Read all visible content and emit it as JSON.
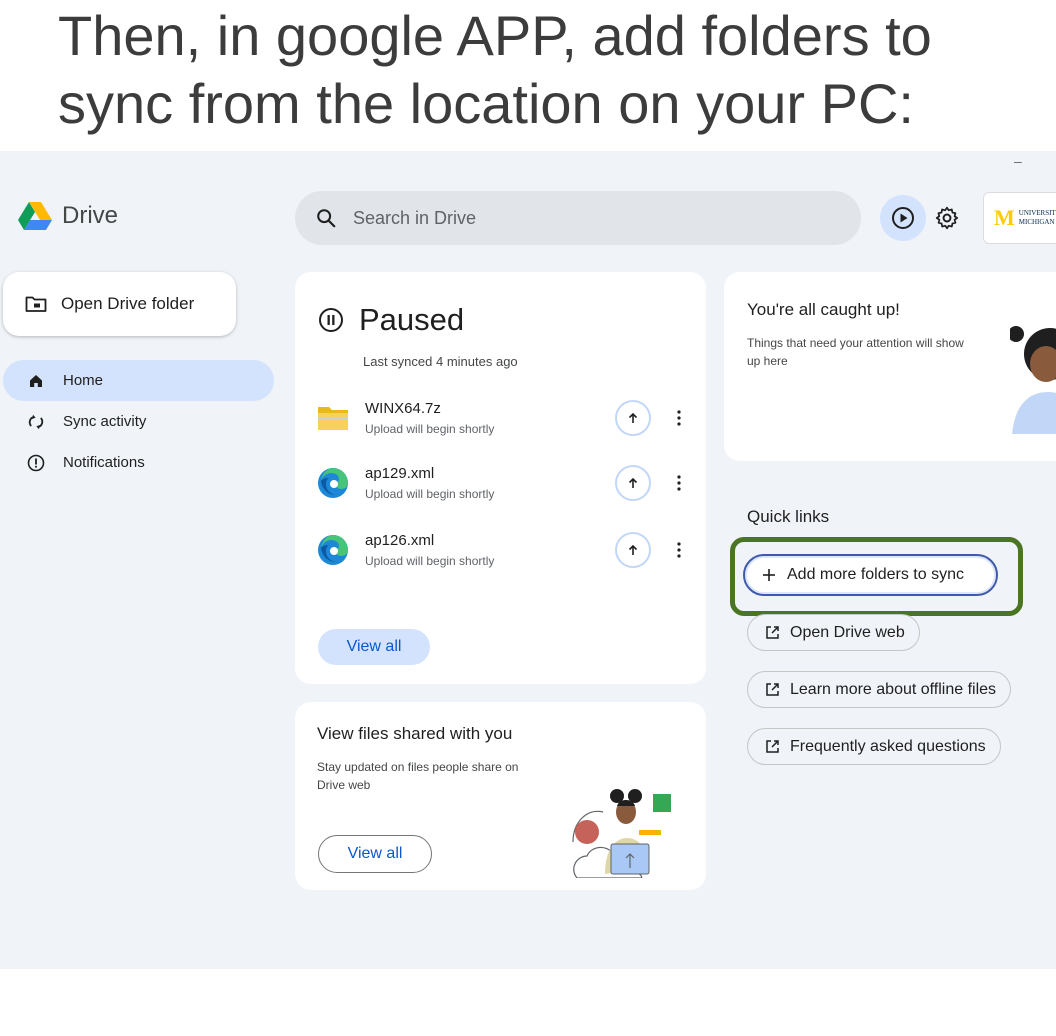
{
  "slide": {
    "title": "Then, in google APP, add folders to sync from the location on your PC:"
  },
  "window": {
    "minimize_glyph": "–"
  },
  "header": {
    "app_name": "Drive",
    "search_placeholder": "Search in Drive",
    "account_logo_letter": "M",
    "account_logo_text": "UNIVERSITY OF MICHIGAN"
  },
  "sidebar": {
    "open_folder_label": "Open Drive folder",
    "items": [
      {
        "label": "Home",
        "icon": "home-icon",
        "active": true
      },
      {
        "label": "Sync activity",
        "icon": "sync-icon",
        "active": false
      },
      {
        "label": "Notifications",
        "icon": "info-icon",
        "active": false
      }
    ]
  },
  "paused_card": {
    "title": "Paused",
    "last_synced": "Last synced 4 minutes ago",
    "files": [
      {
        "name": "WINX64.7z",
        "status": "Upload will begin shortly",
        "icon": "folder-zip-icon"
      },
      {
        "name": "ap129.xml",
        "status": "Upload will begin shortly",
        "icon": "edge-icon"
      },
      {
        "name": "ap126.xml",
        "status": "Upload will begin shortly",
        "icon": "edge-icon"
      }
    ],
    "view_all": "View all"
  },
  "shared_card": {
    "title": "View files shared with you",
    "description": "Stay updated on files people share on Drive web",
    "view_all": "View all"
  },
  "caught_up_card": {
    "title": "You're all caught up!",
    "description": "Things that need your attention will show up here"
  },
  "quick_links": {
    "title": "Quick links",
    "items": [
      {
        "label": "Add more folders to sync",
        "icon": "plus-icon"
      },
      {
        "label": "Open Drive web",
        "icon": "open-external-icon"
      },
      {
        "label": "Learn more about offline files",
        "icon": "open-external-icon"
      },
      {
        "label": "Frequently asked questions",
        "icon": "open-external-icon"
      }
    ]
  },
  "colors": {
    "accent": "#0b57d0",
    "active_nav": "#d3e3fd",
    "highlight": "#4a7523"
  }
}
